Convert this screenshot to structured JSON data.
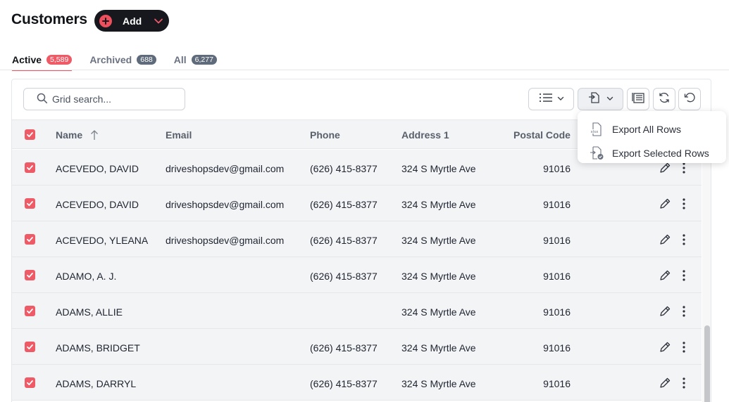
{
  "page": {
    "title": "Customers"
  },
  "add_button": {
    "label": "Add"
  },
  "tabs": [
    {
      "label": "Active",
      "count": "5,589",
      "active": true
    },
    {
      "label": "Archived",
      "count": "688",
      "active": false
    },
    {
      "label": "All",
      "count": "6,277",
      "active": false
    }
  ],
  "search": {
    "placeholder": "Grid search..."
  },
  "columns": {
    "name": "Name",
    "email": "Email",
    "phone": "Phone",
    "address1": "Address 1",
    "postal_code": "Postal Code"
  },
  "rows": [
    {
      "name": "ACEVEDO, DAVID",
      "email": "driveshopsdev@gmail.com",
      "phone": "(626) 415-8377",
      "address1": "324 S Myrtle Ave",
      "postal_code": "91016",
      "checked": true
    },
    {
      "name": "ACEVEDO, DAVID",
      "email": "driveshopsdev@gmail.com",
      "phone": "(626) 415-8377",
      "address1": "324 S Myrtle Ave",
      "postal_code": "91016",
      "checked": true
    },
    {
      "name": "ACEVEDO, YLEANA",
      "email": "driveshopsdev@gmail.com",
      "phone": "(626) 415-8377",
      "address1": "324 S Myrtle Ave",
      "postal_code": "91016",
      "checked": true
    },
    {
      "name": "ADAMO, A. J.",
      "email": "",
      "phone": "(626) 415-8377",
      "address1": "324 S Myrtle Ave",
      "postal_code": "91016",
      "checked": true
    },
    {
      "name": "ADAMS, ALLIE",
      "email": "",
      "phone": "",
      "address1": "324 S Myrtle Ave",
      "postal_code": "91016",
      "checked": true
    },
    {
      "name": "ADAMS, BRIDGET",
      "email": "",
      "phone": "(626) 415-8377",
      "address1": "324 S Myrtle Ave",
      "postal_code": "91016",
      "checked": true
    },
    {
      "name": "ADAMS, DARRYL",
      "email": "",
      "phone": "(626) 415-8377",
      "address1": "324 S Myrtle Ave",
      "postal_code": "91016",
      "checked": true
    }
  ],
  "export_menu": {
    "items": [
      {
        "label": "Export All Rows",
        "icon": "xlsx-file-icon"
      },
      {
        "label": "Export Selected Rows",
        "icon": "export-selected-icon"
      }
    ]
  },
  "colors": {
    "accent": "#ef5a67",
    "dark": "#16181d",
    "row_bg": "#f3f4f6",
    "badge_gray": "#5f6b7a"
  }
}
